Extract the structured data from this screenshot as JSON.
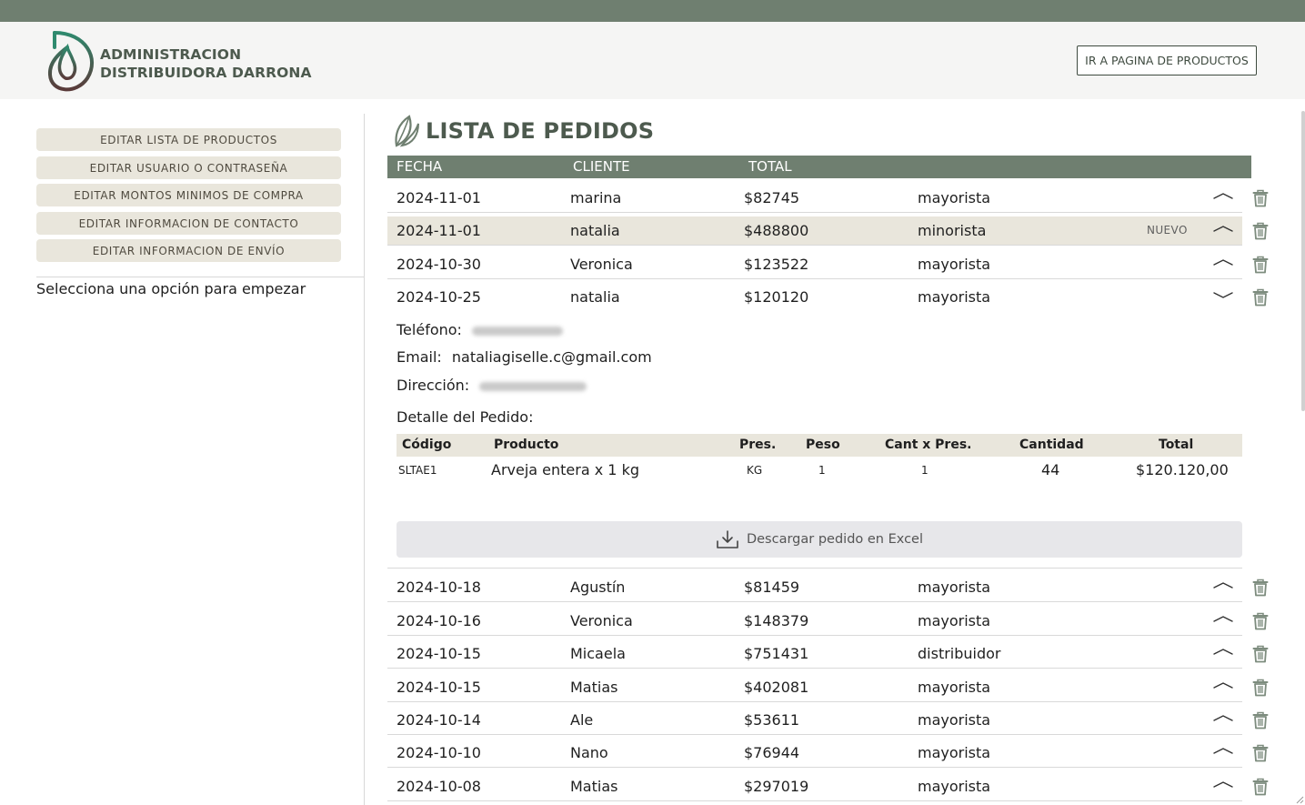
{
  "header": {
    "brand_line1": "ADMINISTRACION",
    "brand_line2": "DISTRIBUIDORA DARRONA",
    "go_products_label": "IR A PAGINA DE PRODUCTOS"
  },
  "sidebar": {
    "items": [
      {
        "label": "EDITAR LISTA DE PRODUCTOS"
      },
      {
        "label": "EDITAR USUARIO O CONTRASEÑA"
      },
      {
        "label": "EDITAR MONTOS MINIMOS DE COMPRA"
      },
      {
        "label": "EDITAR INFORMACION DE CONTACTO"
      },
      {
        "label": "EDITAR INFORMACION DE ENVÍO"
      }
    ],
    "hint": "Selecciona una opción para empezar"
  },
  "main": {
    "title": "LISTA DE PEDIDOS",
    "columns": {
      "fecha": "FECHA",
      "cliente": "CLIENTE",
      "total": "TOTAL"
    },
    "orders": [
      {
        "fecha": "2024-11-01",
        "cliente": "marina",
        "total": "$82745",
        "tipo": "mayorista",
        "badge": "",
        "expanded": false,
        "highlight": false
      },
      {
        "fecha": "2024-11-01",
        "cliente": "natalia",
        "total": "$488800",
        "tipo": "minorista",
        "badge": "NUEVO",
        "expanded": false,
        "highlight": true
      },
      {
        "fecha": "2024-10-30",
        "cliente": "Veronica",
        "total": "$123522",
        "tipo": "mayorista",
        "badge": "",
        "expanded": false,
        "highlight": false
      },
      {
        "fecha": "2024-10-25",
        "cliente": "natalia",
        "total": "$120120",
        "tipo": "mayorista",
        "badge": "",
        "expanded": true,
        "highlight": false
      },
      {
        "fecha": "2024-10-18",
        "cliente": "Agustín",
        "total": "$81459",
        "tipo": "mayorista",
        "badge": "",
        "expanded": false,
        "highlight": false
      },
      {
        "fecha": "2024-10-16",
        "cliente": "Veronica",
        "total": "$148379",
        "tipo": "mayorista",
        "badge": "",
        "expanded": false,
        "highlight": false
      },
      {
        "fecha": "2024-10-15",
        "cliente": "Micaela",
        "total": "$751431",
        "tipo": "distribuidor",
        "badge": "",
        "expanded": false,
        "highlight": false
      },
      {
        "fecha": "2024-10-15",
        "cliente": "Matias",
        "total": "$402081",
        "tipo": "mayorista",
        "badge": "",
        "expanded": false,
        "highlight": false
      },
      {
        "fecha": "2024-10-14",
        "cliente": "Ale",
        "total": "$53611",
        "tipo": "mayorista",
        "badge": "",
        "expanded": false,
        "highlight": false
      },
      {
        "fecha": "2024-10-10",
        "cliente": "Nano",
        "total": "$76944",
        "tipo": "mayorista",
        "badge": "",
        "expanded": false,
        "highlight": false
      },
      {
        "fecha": "2024-10-08",
        "cliente": "Matias",
        "total": "$297019",
        "tipo": "mayorista",
        "badge": "",
        "expanded": false,
        "highlight": false
      }
    ],
    "detail": {
      "telefono_label": "Teléfono:",
      "email_label": "Email:",
      "email_value": "nataliagiselle.c@gmail.com",
      "direccion_label": "Dirección:",
      "detalle_label": "Detalle del Pedido:",
      "table_headers": {
        "codigo": "Código",
        "producto": "Producto",
        "pres": "Pres.",
        "peso": "Peso",
        "cant_x_pres": "Cant x Pres.",
        "cantidad": "Cantidad",
        "total": "Total"
      },
      "items": [
        {
          "codigo": "SLTAE1",
          "producto": "Arveja entera x 1 kg",
          "pres": "KG",
          "peso": "1",
          "cant_x_pres": "1",
          "cantidad": "44",
          "total": "$120.120,00"
        }
      ],
      "download_label": "Descargar pedido en Excel"
    }
  },
  "colors": {
    "accent": "#6f7f70",
    "title": "#4d5a4e",
    "highlight_row": "#e9e6dc",
    "trash": "#7d8c7e"
  }
}
